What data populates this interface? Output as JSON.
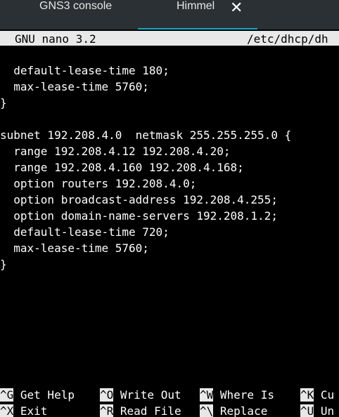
{
  "tabs": [
    {
      "label": "GNS3 console",
      "active": false
    },
    {
      "label": "Himmel",
      "active": true,
      "close_icon": "close-icon"
    }
  ],
  "nano": {
    "version": "GNU nano 3.2",
    "filename": "/etc/dhcp/dh"
  },
  "editor": {
    "lines": [
      "  default-lease-time 180;",
      "  max-lease-time 5760;",
      "}",
      "",
      "subnet 192.208.4.0  netmask 255.255.255.0 {",
      "  range 192.208.4.12 192.208.4.20;",
      "  range 192.208.4.160 192.208.4.168;",
      "  option routers 192.208.4.0;",
      "  option broadcast-address 192.208.4.255;",
      "  option domain-name-servers 192.208.1.2;",
      "  default-lease-time 720;",
      "  max-lease-time 5760;",
      "}"
    ]
  },
  "shortcuts": {
    "row1": [
      {
        "key": "^G",
        "label": " Get Help"
      },
      {
        "key": "^O",
        "label": " Write Out"
      },
      {
        "key": "^W",
        "label": " Where Is"
      },
      {
        "key": "^K",
        "label": " Cu"
      }
    ],
    "row2": [
      {
        "key": "^X",
        "label": " Exit"
      },
      {
        "key": "^R",
        "label": " Read File"
      },
      {
        "key": "^\\",
        "label": " Replace"
      },
      {
        "key": "^U",
        "label": " Un"
      }
    ]
  }
}
